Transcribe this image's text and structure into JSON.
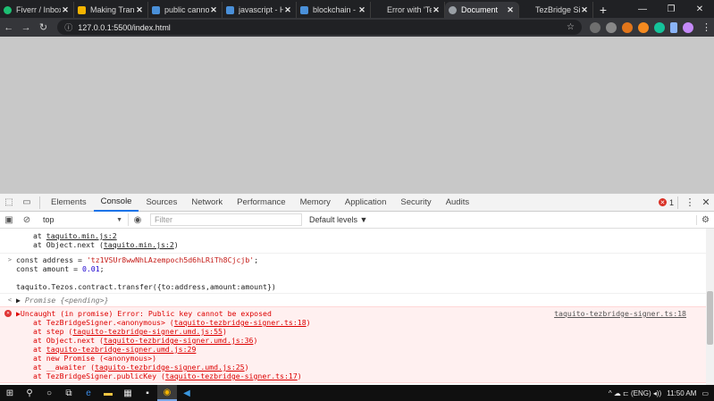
{
  "tabs": [
    {
      "label": "Fiverr / Inbox",
      "color": "#1dbf73"
    },
    {
      "label": "Making Transf",
      "color": "#f4b400"
    },
    {
      "label": "public cannot",
      "color": "#4a90d9"
    },
    {
      "label": "javascript - Ho",
      "color": "#4a90d9"
    },
    {
      "label": "blockchain - C",
      "color": "#4a90d9"
    },
    {
      "label": "Error with 'Tez",
      "color": "#202124"
    },
    {
      "label": "Document",
      "color": "#ffffff",
      "active": true
    },
    {
      "label": "TezBridge Sign",
      "color": "#202124"
    }
  ],
  "window_controls": {
    "minimize": "—",
    "restore": "❐",
    "close": "✕"
  },
  "address_bar": {
    "url": "127.0.0.1:5500/index.html"
  },
  "devtools": {
    "tabs": [
      "Elements",
      "Console",
      "Sources",
      "Network",
      "Performance",
      "Memory",
      "Application",
      "Security",
      "Audits"
    ],
    "active_tab": "Console",
    "error_count": "1"
  },
  "console_toolbar": {
    "context": "top",
    "filter_placeholder": "Filter",
    "levels": "Default levels ▼"
  },
  "console": {
    "top_stack": [
      {
        "prefix": "at ",
        "link": "taquito.min.js:2",
        "suffix": ""
      },
      {
        "prefix": "at Object.next (",
        "link": "taquito.min.js:2",
        "suffix": ")"
      }
    ],
    "input1": {
      "line1_a": "const address = ",
      "line1_str": "'tz1VSUr8wwNhLAzempoch5d6hLRiTh8Cjcjb'",
      "line1_b": ";",
      "line2_a": "const amount = ",
      "line2_num": "0.01",
      "line2_b": ";",
      "line3": "",
      "line4": "taquito.Tezos.contract.transfer({to:address,amount:amount})"
    },
    "result": {
      "label": "Promise",
      "value": "{<pending>}"
    },
    "error": {
      "message": "▶Uncaught (in promise) Error: Public key cannot be exposed",
      "source": "taquito-tezbridge-signer.ts:18",
      "stack": [
        {
          "prefix": "at TezBridgeSigner.<anonymous> (",
          "link": "taquito-tezbridge-signer.ts:18",
          "suffix": ")"
        },
        {
          "prefix": "at step (",
          "link": "taquito-tezbridge-signer.umd.js:55",
          "suffix": ")"
        },
        {
          "prefix": "at Object.next (",
          "link": "taquito-tezbridge-signer.umd.js:36",
          "suffix": ")"
        },
        {
          "prefix": "at ",
          "link": "taquito-tezbridge-signer.umd.js:29",
          "suffix": ""
        },
        {
          "prefix": "at new Promise (<anonymous>)",
          "link": "",
          "suffix": ""
        },
        {
          "prefix": "at __awaiter (",
          "link": "taquito-tezbridge-signer.umd.js:25",
          "suffix": ")"
        },
        {
          "prefix": "at TezBridgeSigner.publicKey (",
          "link": "taquito-tezbridge-signer.ts:17",
          "suffix": ")"
        }
      ]
    }
  },
  "taskbar": {
    "time": "11:50 AM",
    "tray_text": "^ ☁ ⊏ (ENG) ◂))"
  }
}
